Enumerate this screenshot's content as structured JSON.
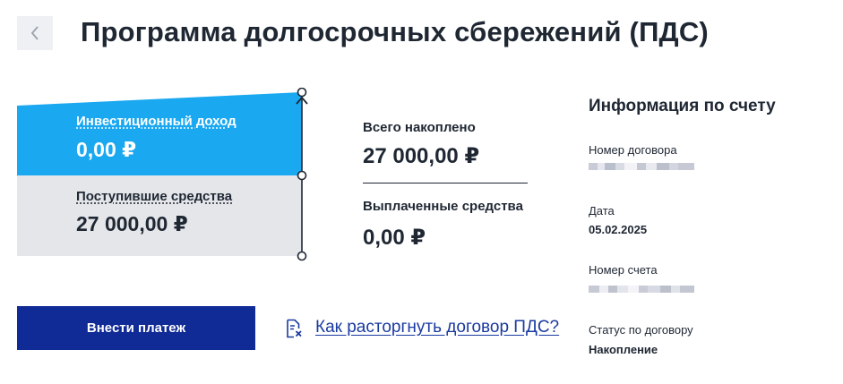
{
  "header": {
    "title": "Программа долгосрочных сбережений (ПДС)",
    "back_icon": "chevron-left-icon"
  },
  "breakdown": {
    "investment_income": {
      "label": "Инвестиционный доход",
      "value": "0,00 ₽"
    },
    "received_funds": {
      "label": "Поступившие средства",
      "value": "27 000,00 ₽"
    },
    "colors": {
      "income": "#1aa8f0",
      "received": "#e4e6ea",
      "line": "#1f2733"
    }
  },
  "totals": {
    "accumulated_label": "Всего накоплено",
    "accumulated_value": "27 000,00 ₽",
    "paid_label": "Выплаченные средства",
    "paid_value": "0,00 ₽"
  },
  "info": {
    "title": "Информация по счету",
    "contract_number_label": "Номер договора",
    "date_label": "Дата",
    "date_value": "05.02.2025",
    "account_number_label": "Номер счета",
    "status_label": "Статус по договору",
    "status_value": "Накопление"
  },
  "actions": {
    "pay_button": "Внести платеж",
    "help_link": "Как расторгнуть договор ПДС?",
    "help_icon": "document-close-icon"
  },
  "colors": {
    "primary": "#102a96",
    "link": "#1a3aa0",
    "text": "#1f2733"
  }
}
